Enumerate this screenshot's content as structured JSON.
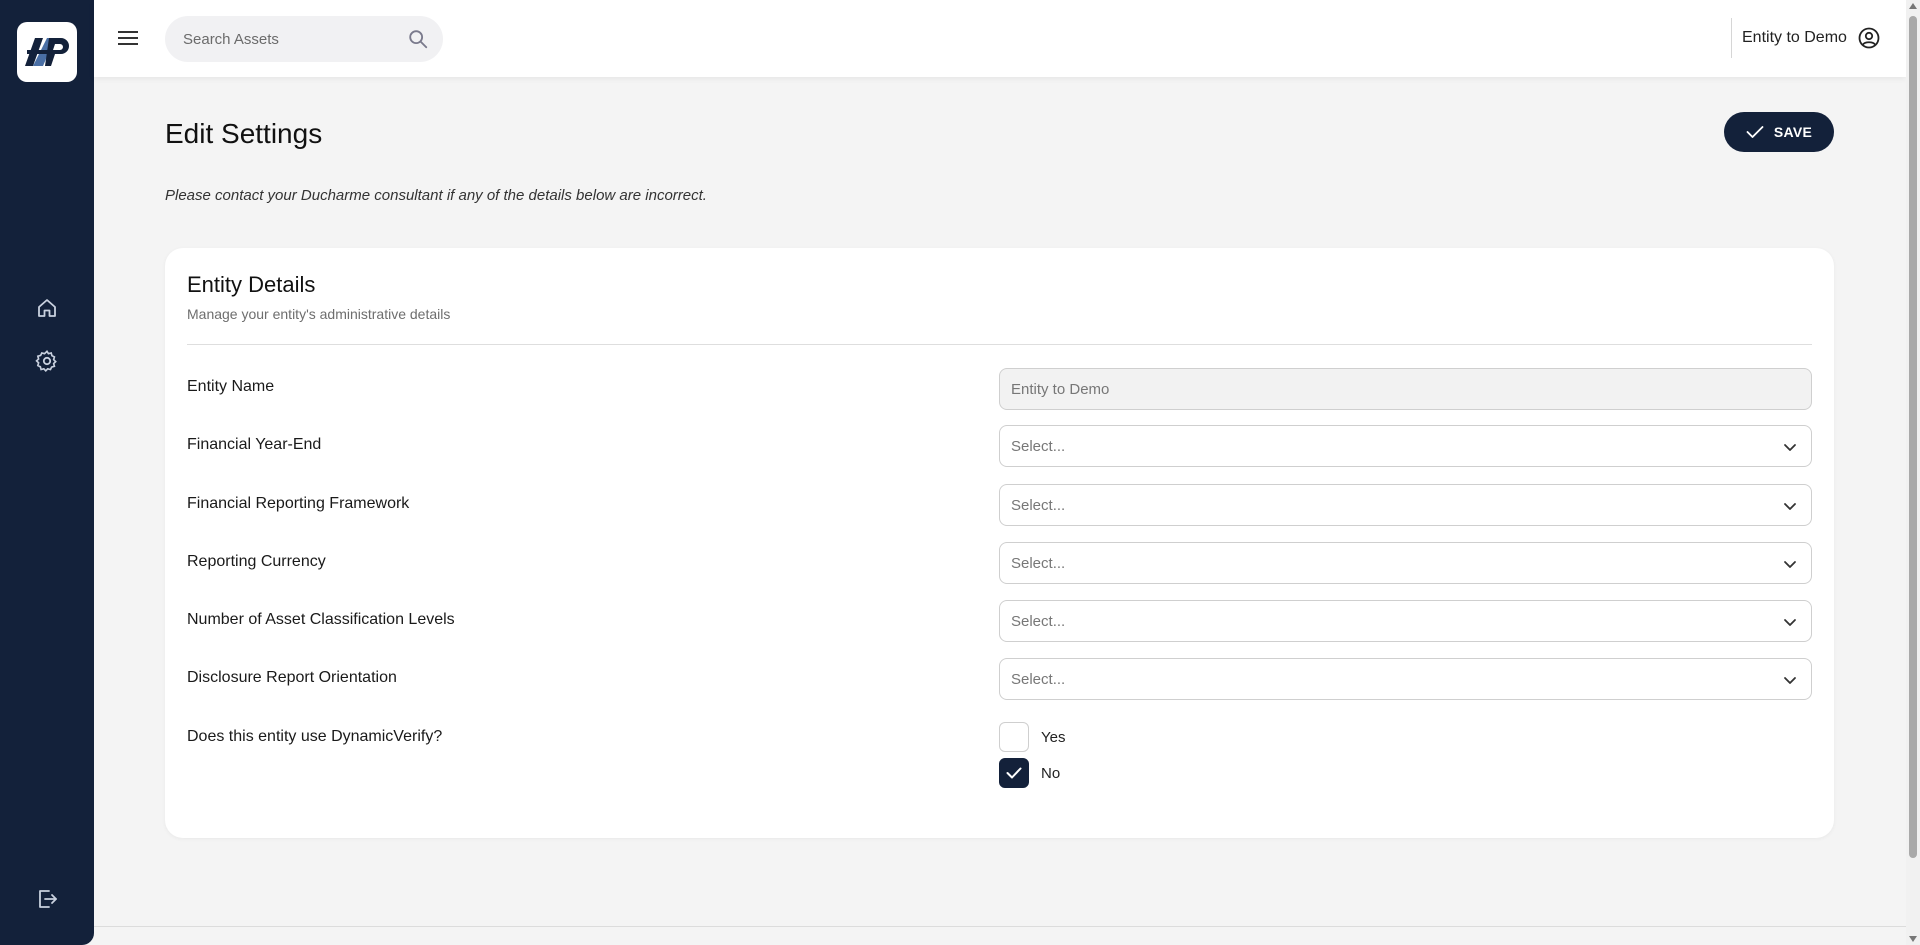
{
  "header": {
    "search_placeholder": "Search Assets",
    "user_name": "Entity to Demo"
  },
  "page": {
    "title": "Edit Settings",
    "save_label": "SAVE",
    "notice": "Please contact your Ducharme consultant if any of the details below are incorrect."
  },
  "card": {
    "title": "Entity Details",
    "subtitle": "Manage your entity's administrative details",
    "fields": [
      {
        "label": "Entity Name",
        "value": "Entity to Demo"
      },
      {
        "label": "Financial Year-End",
        "value": "Select..."
      },
      {
        "label": "Financial Reporting Framework",
        "value": "Select..."
      },
      {
        "label": "Reporting Currency",
        "value": "Select..."
      },
      {
        "label": "Number of Asset Classification Levels",
        "value": "Select..."
      },
      {
        "label": "Disclosure Report Orientation",
        "value": "Select..."
      }
    ],
    "dynamic_verify": {
      "label": "Does this entity use DynamicVerify?",
      "options": [
        {
          "label": "Yes",
          "checked": false
        },
        {
          "label": "No",
          "checked": true
        }
      ]
    }
  },
  "colors": {
    "navy": "#13213a",
    "background": "#f4f4f4"
  },
  "icons": [
    "logo",
    "home-icon",
    "gear-icon",
    "logout-icon",
    "menu-icon",
    "search-icon",
    "user-circle-icon",
    "check-icon",
    "chevron-down-icon"
  ]
}
